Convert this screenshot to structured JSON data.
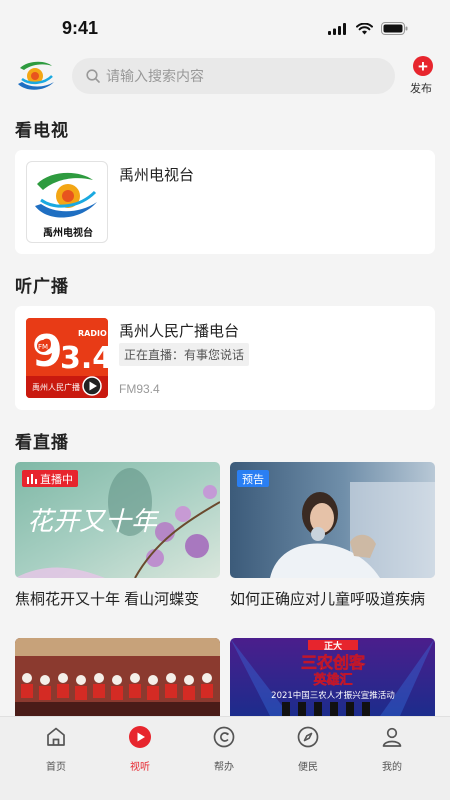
{
  "status": {
    "time": "9:41"
  },
  "search": {
    "placeholder": "请输入搜索内容"
  },
  "header": {
    "publish_label": "发布"
  },
  "tv": {
    "section_title": "看电视",
    "channel_name": "禹州电视台",
    "logo_text": "禹州电视台"
  },
  "radio": {
    "section_title": "听广播",
    "station_name": "禹州人民广播电台",
    "live_label": "正在直播：有事您说话",
    "frequency": "FM93.4",
    "thumb_brand": "RADIO",
    "thumb_fm": "FM",
    "thumb_caption": "禹州人民广播"
  },
  "live": {
    "section_title": "看直播",
    "videos": [
      {
        "badge": "直播中",
        "title": "焦桐花开又十年 看山河蝶变",
        "art_text": "花开又十年"
      },
      {
        "badge": "预告",
        "title": "如何正确应对儿童呼吸道疾病"
      },
      {
        "title": ""
      },
      {
        "art_line1": "正大",
        "art_line2": "三农创客",
        "art_line3": "英雄汇",
        "art_caption": "2021中国三农人才振兴宣推活动"
      }
    ]
  },
  "tabbar": {
    "items": [
      {
        "label": "首页",
        "icon": "home-icon"
      },
      {
        "label": "视听",
        "icon": "play-icon",
        "active": true
      },
      {
        "label": "帮办",
        "icon": "help-icon"
      },
      {
        "label": "便民",
        "icon": "compass-icon"
      },
      {
        "label": "我的",
        "icon": "user-icon"
      }
    ]
  },
  "colors": {
    "accent": "#e7252d",
    "preview_badge": "#2a7ff3",
    "background": "#f4f4f4"
  }
}
